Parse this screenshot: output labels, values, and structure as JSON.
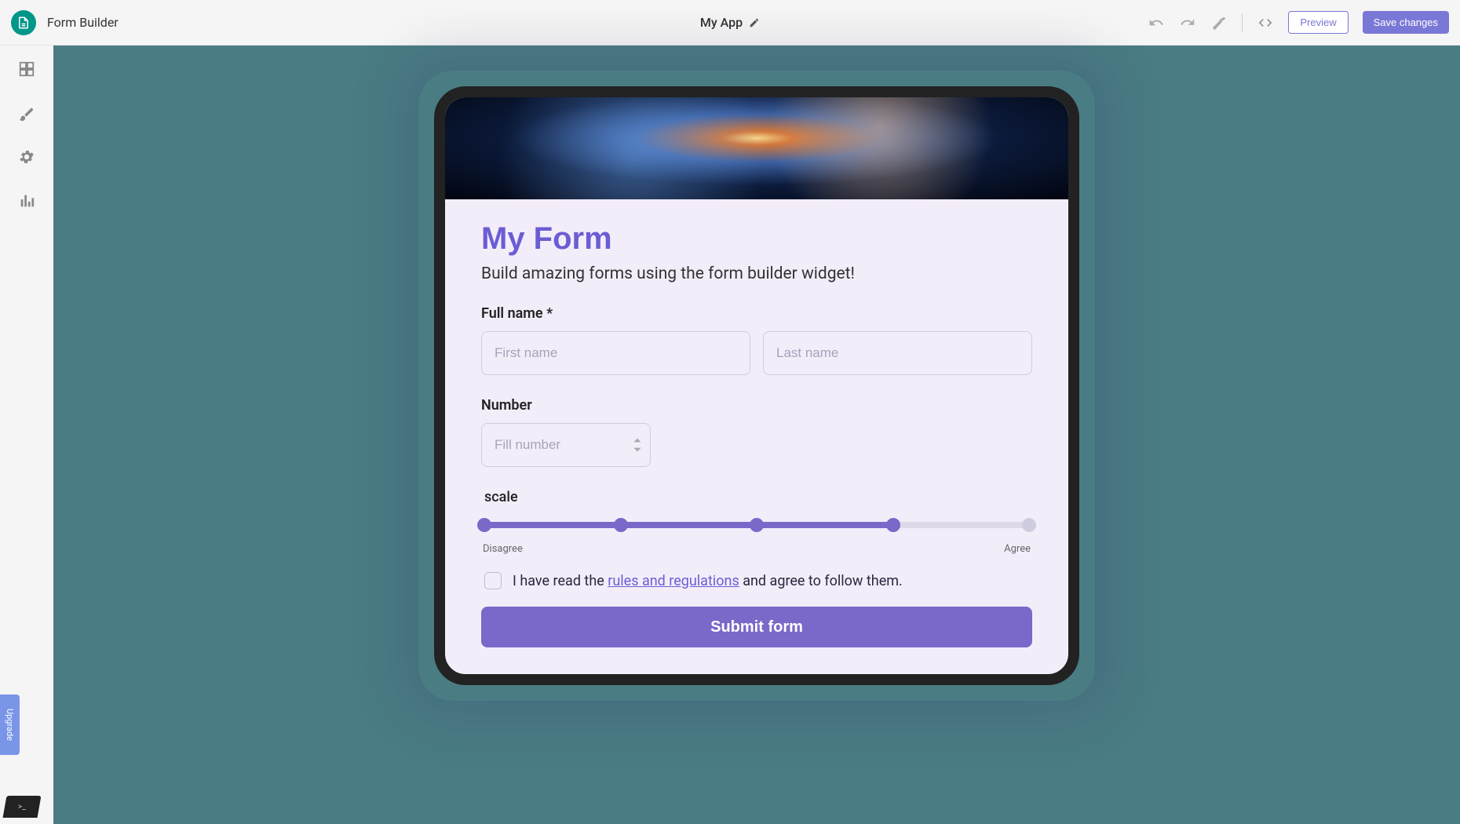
{
  "header": {
    "section_title": "Form Builder",
    "app_name": "My App",
    "preview_label": "Preview",
    "save_label": "Save changes"
  },
  "sidebar": {
    "upgrade_label": "Upgrade"
  },
  "form": {
    "title": "My Form",
    "subtitle": "Build amazing forms using the form builder widget!",
    "full_name_label": "Full name *",
    "first_name_placeholder": "First name",
    "last_name_placeholder": "Last name",
    "number_label": "Number",
    "number_placeholder": "Fill number",
    "scale_label": "scale",
    "scale_left": "Disagree",
    "scale_right": "Agree",
    "consent_prefix": "I have read the ",
    "consent_link": "rules and regulations",
    "consent_suffix": " and agree to follow them.",
    "submit_label": "Submit form"
  },
  "scale": {
    "steps": 5,
    "value": 4
  },
  "colors": {
    "accent": "#7b68c9",
    "canvas_bg": "#4a7c84"
  }
}
